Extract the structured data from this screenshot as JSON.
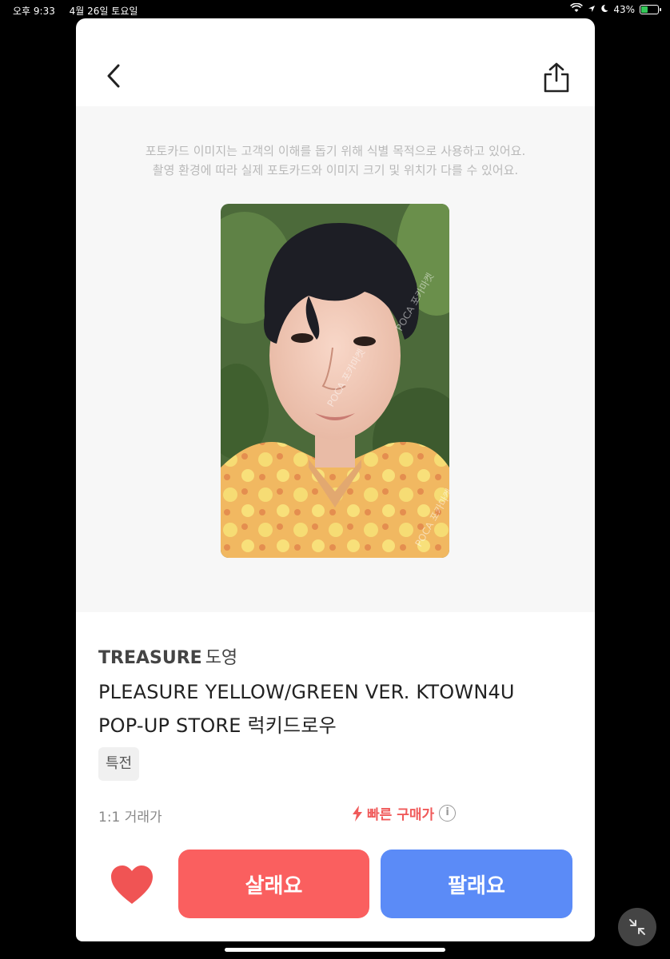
{
  "status_bar": {
    "time": "오후 9:33",
    "date": "4월 26일 토요일",
    "battery": "43%",
    "battery_level": 0.43
  },
  "header": {
    "back_icon": "chevron-left-icon",
    "share_icon": "share-icon"
  },
  "notice": {
    "line1": "포토카드 이미지는 고객의 이해를 돕기 위해 식별 목적으로 사용하고 있어요.",
    "line2": "촬영 환경에 따라 실제 포토카드와 이미지 크기 및 위치가 다를 수 있어요."
  },
  "photocard": {
    "watermark": "POCA 포카마켓"
  },
  "product": {
    "group": "TREASURE",
    "member": "도영",
    "title_line1": "PLEASURE YELLOW/GREEN VER. KTOWN4U",
    "title_line2": "POP-UP STORE 럭키드로우",
    "tag": "특전"
  },
  "trade": {
    "type": "1:1 거래가",
    "fast_buy": "빠른 구매가",
    "info_icon": "i"
  },
  "actions": {
    "buy": "살래요",
    "sell": "팔래요"
  },
  "colors": {
    "buy": "#fa5f5f",
    "sell": "#5b8bf7",
    "heart": "#f05454",
    "fast_buy": "#f05a5a"
  }
}
